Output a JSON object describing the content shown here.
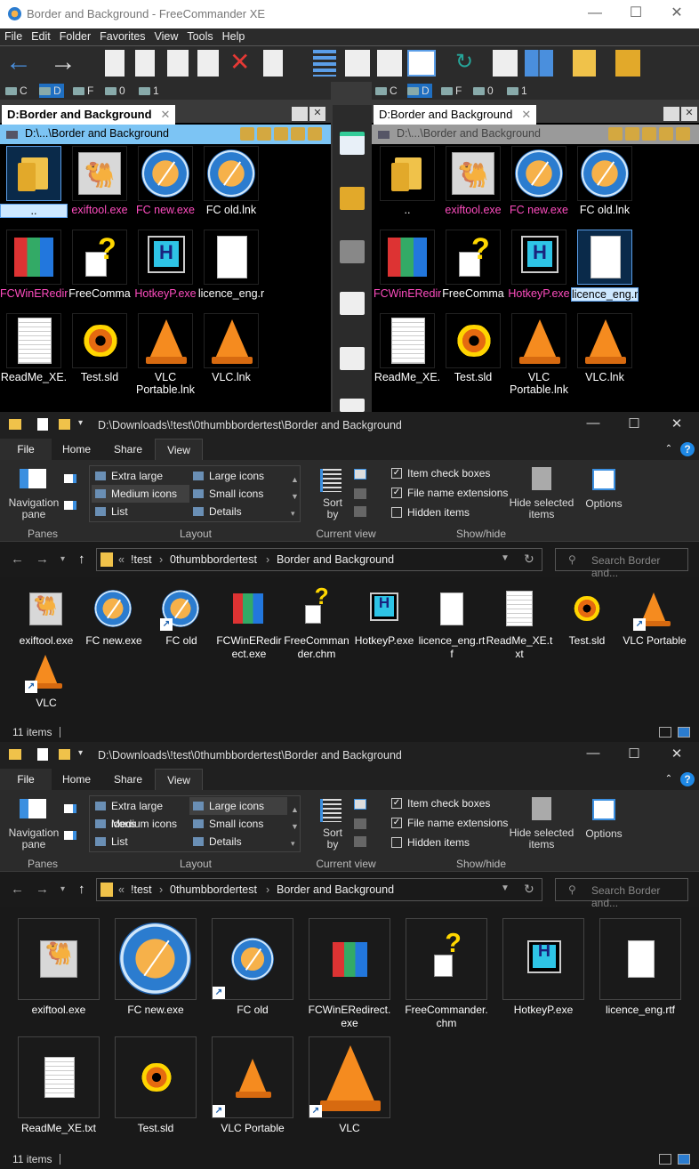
{
  "fc": {
    "title": "Border and Background - FreeCommander XE",
    "menu": [
      "File",
      "Edit",
      "Folder",
      "Favorites",
      "View",
      "Tools",
      "Help"
    ],
    "drives": [
      "C",
      "D",
      "F",
      "0",
      "1"
    ],
    "left": {
      "tab": "D:Border and Background",
      "path": "D:\\...\\Border and Background"
    },
    "right": {
      "tab": "D:Border and Background",
      "path": "D:\\...\\Border and Background"
    },
    "files_left": [
      {
        "name": "..",
        "color": "white",
        "icon": "folder-icon"
      },
      {
        "name": "exiftool.exe",
        "color": "pink",
        "icon": "camel-icon"
      },
      {
        "name": "FC new.exe",
        "color": "pink",
        "icon": "compass-icon"
      },
      {
        "name": "FC old.lnk",
        "color": "white",
        "icon": "compass-icon"
      },
      {
        "name": "FCWinERedir",
        "color": "pink",
        "icon": "fcwin-icon"
      },
      {
        "name": "FreeComma",
        "color": "white",
        "icon": "chm-icon"
      },
      {
        "name": "HotkeyP.exe",
        "color": "pink",
        "icon": "hotkey-icon"
      },
      {
        "name": "licence_eng.r",
        "color": "white",
        "icon": "document-icon"
      },
      {
        "name": "ReadMe_XE.",
        "color": "white",
        "icon": "document-icon"
      },
      {
        "name": "Test.sld",
        "color": "white",
        "icon": "eye-icon"
      },
      {
        "name": "VLC Portable.lnk",
        "color": "white",
        "icon": "cone-icon"
      },
      {
        "name": "VLC.lnk",
        "color": "white",
        "icon": "cone-icon"
      }
    ],
    "files_right": [
      {
        "name": "..",
        "color": "white"
      },
      {
        "name": "exiftool.exe",
        "color": "pink"
      },
      {
        "name": "FC new.exe",
        "color": "pink"
      },
      {
        "name": "FC old.lnk",
        "color": "white"
      },
      {
        "name": "FCWinERedir",
        "color": "pink"
      },
      {
        "name": "FreeComma",
        "color": "white"
      },
      {
        "name": "HotkeyP.exe",
        "color": "pink"
      },
      {
        "name": "licence_eng.r",
        "color": "white"
      },
      {
        "name": "ReadMe_XE.",
        "color": "white"
      },
      {
        "name": "Test.sld",
        "color": "white"
      },
      {
        "name": "VLC Portable.lnk",
        "color": "white"
      },
      {
        "name": "VLC.lnk",
        "color": "white"
      }
    ]
  },
  "explorer1": {
    "title_path": "D:\\Downloads\\!test\\0thumbbordertest\\Border and Background",
    "tabs": {
      "file": "File",
      "home": "Home",
      "share": "Share",
      "view": "View"
    },
    "ribbon": {
      "nav_pane": "Navigation pane",
      "panes": "Panes",
      "layout": "Layout",
      "current_view": "Current view",
      "show_hide": "Show/hide",
      "extra_large": "Extra large icons",
      "large": "Large icons",
      "medium": "Medium icons",
      "small": "Small icons",
      "list": "List",
      "details": "Details",
      "sort_by": "Sort by",
      "item_check": "Item check boxes",
      "file_ext": "File name extensions",
      "hidden": "Hidden items",
      "hide_selected": "Hide selected items",
      "options": "Options"
    },
    "address": {
      "prefix": "«",
      "crumbs": [
        "!test",
        "0thumbbordertest",
        "Border and Background"
      ]
    },
    "search_placeholder": "Search Border and...",
    "files": [
      "exiftool.exe",
      "FC new.exe",
      "FC old",
      "FCWinERedirect.exe",
      "FreeCommander.chm",
      "HotkeyP.exe",
      "licence_eng.rtf",
      "ReadMe_XE.txt",
      "Test.sld",
      "VLC Portable",
      "VLC"
    ],
    "status": "11 items"
  },
  "explorer2": {
    "title_path": "D:\\Downloads\\!test\\0thumbbordertest\\Border and Background",
    "files": [
      "exiftool.exe",
      "FC new.exe",
      "FC old",
      "FCWinERedirect.exe",
      "FreeCommander.chm",
      "HotkeyP.exe",
      "licence_eng.rtf",
      "ReadMe_XE.txt",
      "Test.sld",
      "VLC Portable",
      "VLC"
    ],
    "status": "11 items"
  }
}
